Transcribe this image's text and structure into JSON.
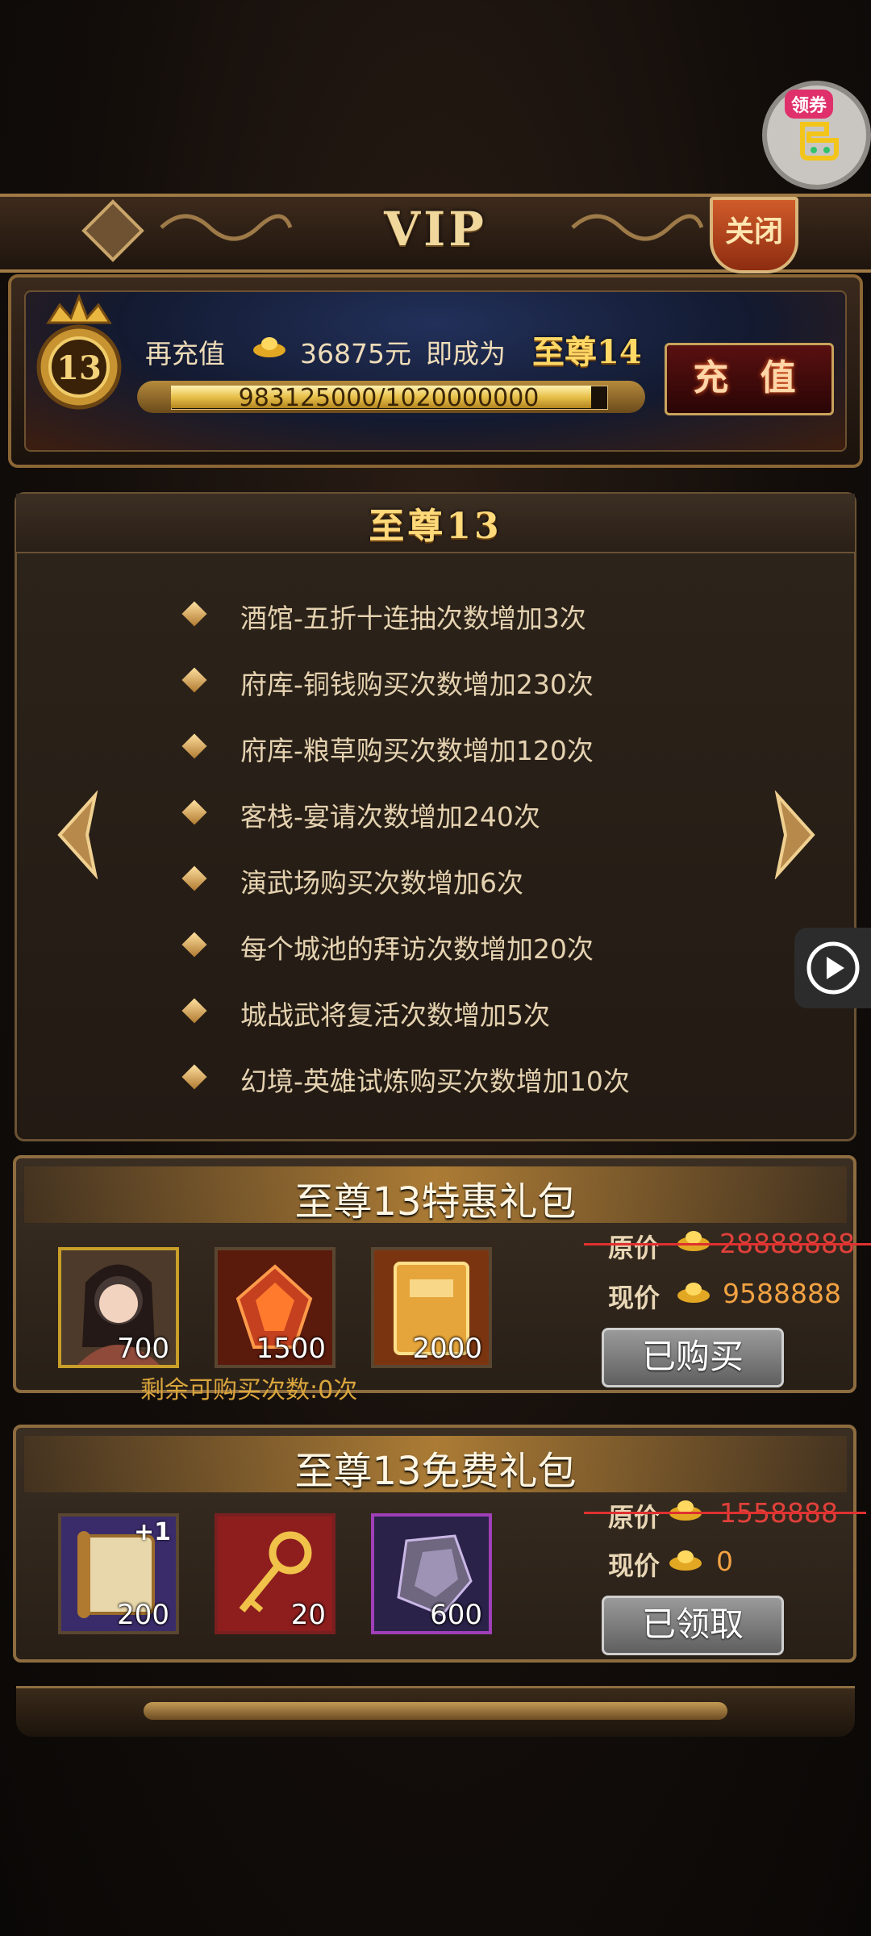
{
  "coupon": {
    "tag": "领券"
  },
  "header": {
    "title": "VIP",
    "close_label": "关闭"
  },
  "recharge": {
    "vip_level": "13",
    "prefix": "再充值",
    "amount": "36875元",
    "suffix": "即成为",
    "next_level": "至尊14",
    "progress_text": "983125000/1020000000",
    "progress_fraction": 0.9639,
    "button_label": "充 值"
  },
  "privileges": {
    "title": "至尊13",
    "items": [
      "酒馆-五折十连抽次数增加3次",
      "府库-铜钱购买次数增加230次",
      "府库-粮草购买次数增加120次",
      "客栈-宴请次数增加240次",
      "演武场购买次数增加6次",
      "每个城池的拜访次数增加20次",
      "城战武将复活次数增加5次",
      "幻境-英雄试炼购买次数增加10次"
    ]
  },
  "special_pack": {
    "title": "至尊13特惠礼包",
    "items": [
      {
        "icon": "hero-portrait-icon",
        "count": "700"
      },
      {
        "icon": "red-gem-icon",
        "count": "1500"
      },
      {
        "icon": "golden-book-icon",
        "count": "2000"
      }
    ],
    "original_label": "原价",
    "original_price": "28888888",
    "current_label": "现价",
    "current_price": "9588888",
    "button_label": "已购买",
    "remaining": "剩余可购买次数:0次"
  },
  "free_pack": {
    "title": "至尊13免费礼包",
    "items": [
      {
        "icon": "scroll-icon",
        "badge": "+1",
        "count": "200"
      },
      {
        "icon": "golden-key-icon",
        "count": "20"
      },
      {
        "icon": "purple-stone-icon",
        "count": "600"
      }
    ],
    "original_label": "原价",
    "original_price": "1558888",
    "current_label": "现价",
    "current_price": "0",
    "button_label": "已领取"
  },
  "colors": {
    "gold": "#ffd97a",
    "frame": "#8d6c40",
    "red_price": "#e0403a",
    "orange_price": "#f2a243"
  }
}
